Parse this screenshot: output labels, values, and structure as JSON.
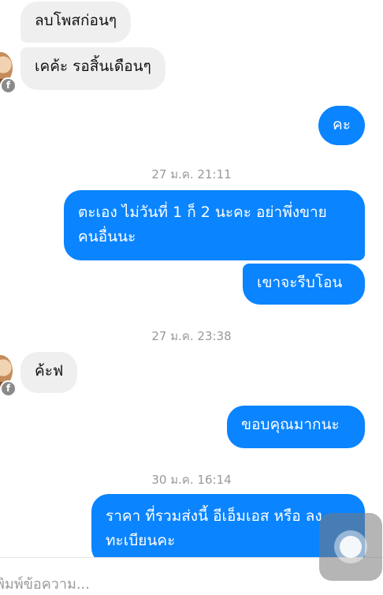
{
  "messages": [
    {
      "text": "ลบโพสก่อนๆ"
    },
    {
      "text": "เคค้ะ รอสิ้นเดือนๆ"
    },
    {
      "text": "คะ"
    },
    {
      "timestamp": "27 ม.ค. 21:11"
    },
    {
      "line1": "ตะเอง ไม่วันที่ 1 ก็ 2 นะคะ อย่าพึ่งขาย",
      "line2": "คนอื่นนะ"
    },
    {
      "text": "เขาจะรีบโอน"
    },
    {
      "timestamp": "27 ม.ค. 23:38"
    },
    {
      "text": "ค้ะฟ"
    },
    {
      "text": "ขอบคุณมากนะ"
    },
    {
      "timestamp": "30 ม.ค. 16:14"
    },
    {
      "line1": "ราคา ที่รวมส่งนี้ อีเอ็มเอส หรือ ลง",
      "line2": "ทะเบียนคะ"
    }
  ],
  "composer": {
    "placeholder": "พิมพ์ข้อความ..."
  },
  "icons": {
    "avatar": "contact-avatar",
    "badge": "facebook-badge-icon",
    "assistive": "assistive-touch-icon"
  },
  "colors": {
    "incoming_bubble": "#efefef",
    "outgoing_bubble": "#0a84ff",
    "timestamp": "#999999"
  }
}
